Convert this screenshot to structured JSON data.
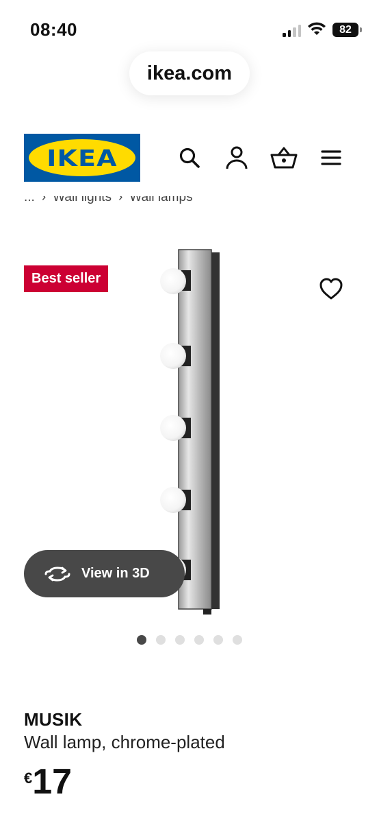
{
  "status_bar": {
    "time": "08:40",
    "battery": "82"
  },
  "browser": {
    "url": "ikea.com"
  },
  "header": {
    "logo_text": "IKEA",
    "logo_colors": {
      "blue": "#0058a3",
      "yellow": "#ffdb00"
    },
    "icons": [
      "search-icon",
      "profile-icon",
      "basket-icon",
      "menu-icon"
    ]
  },
  "breadcrumb": {
    "items": [
      "...",
      "Wall lights",
      "Wall lamps"
    ],
    "separator": "›"
  },
  "product_image": {
    "badge": "Best seller",
    "badge_color": "#cc0033",
    "view_3d_label": "View in 3D",
    "carousel": {
      "total": 6,
      "active": 1
    }
  },
  "product": {
    "name": "MUSIK",
    "description": "Wall lamp, chrome-plated",
    "currency": "€",
    "price": "17"
  }
}
